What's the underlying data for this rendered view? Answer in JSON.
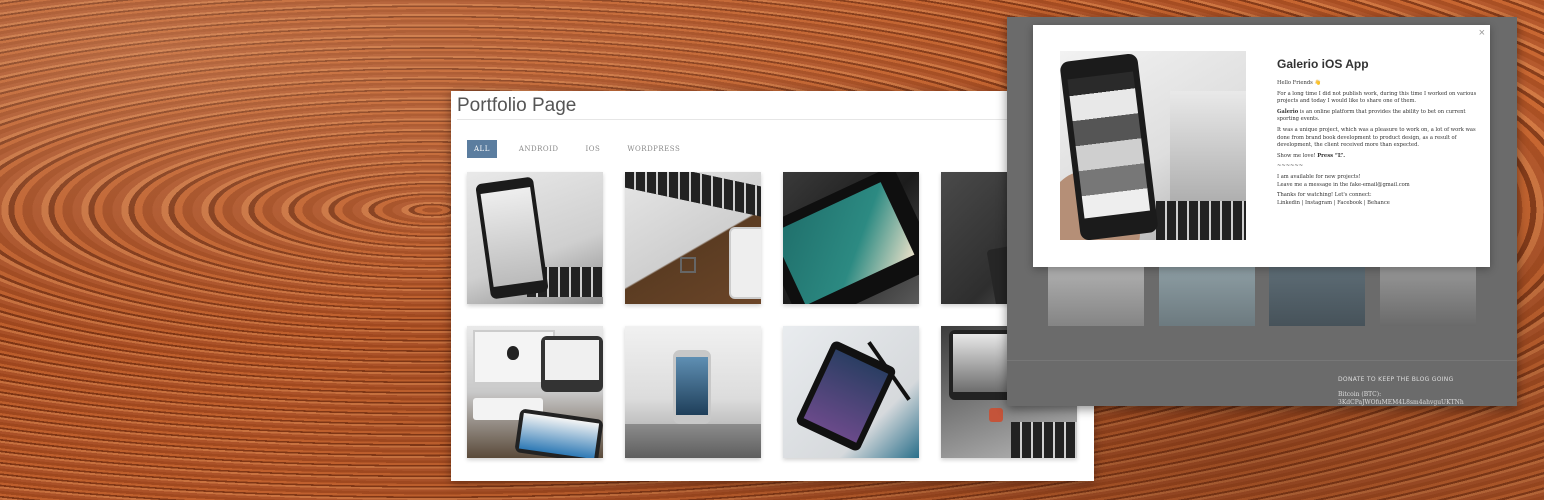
{
  "portfolio": {
    "title": "Portfolio Page",
    "filters": [
      {
        "label": "ALL",
        "active": true
      },
      {
        "label": "ANDROID",
        "active": false
      },
      {
        "label": "IOS",
        "active": false
      },
      {
        "label": "WORDPRESS",
        "active": false
      }
    ]
  },
  "modal": {
    "close_glyph": "×",
    "title": "Galerio iOS App",
    "greeting": "Hello Friends 👋",
    "intro": "For a long time I did not publish work, during this time I worked on various projects and today I would like to share one of them.",
    "galerio_name": "Galerio",
    "galerio_desc": " is an online platform that provides the ability to bet on current sporting events.",
    "project_desc": "It was a unique project, which was a pleasure to work on, a lot of work was done from brand book development to product design, as a result of development, the client received more than expected.",
    "love_prefix": "Show me love! ",
    "love_strong": "Press “L”.",
    "divider": "~~~~~~",
    "available": "I am available for new projects!",
    "message": "Leave me a message in the fake-email@gmail.com",
    "thanks": "Thanks for watching! Let's connect:",
    "social": "Linkedin | Instagram | Facebook | Behance"
  },
  "footer": {
    "donate_title": "DONATE TO KEEP THE BLOG GOING",
    "bitcoin_label": "Bitcoin (BTC):",
    "bitcoin_address": "3KdCPaJWOfuMEM4L8sm4ahvguUKTNh"
  },
  "icons": {
    "close": "close-icon"
  }
}
